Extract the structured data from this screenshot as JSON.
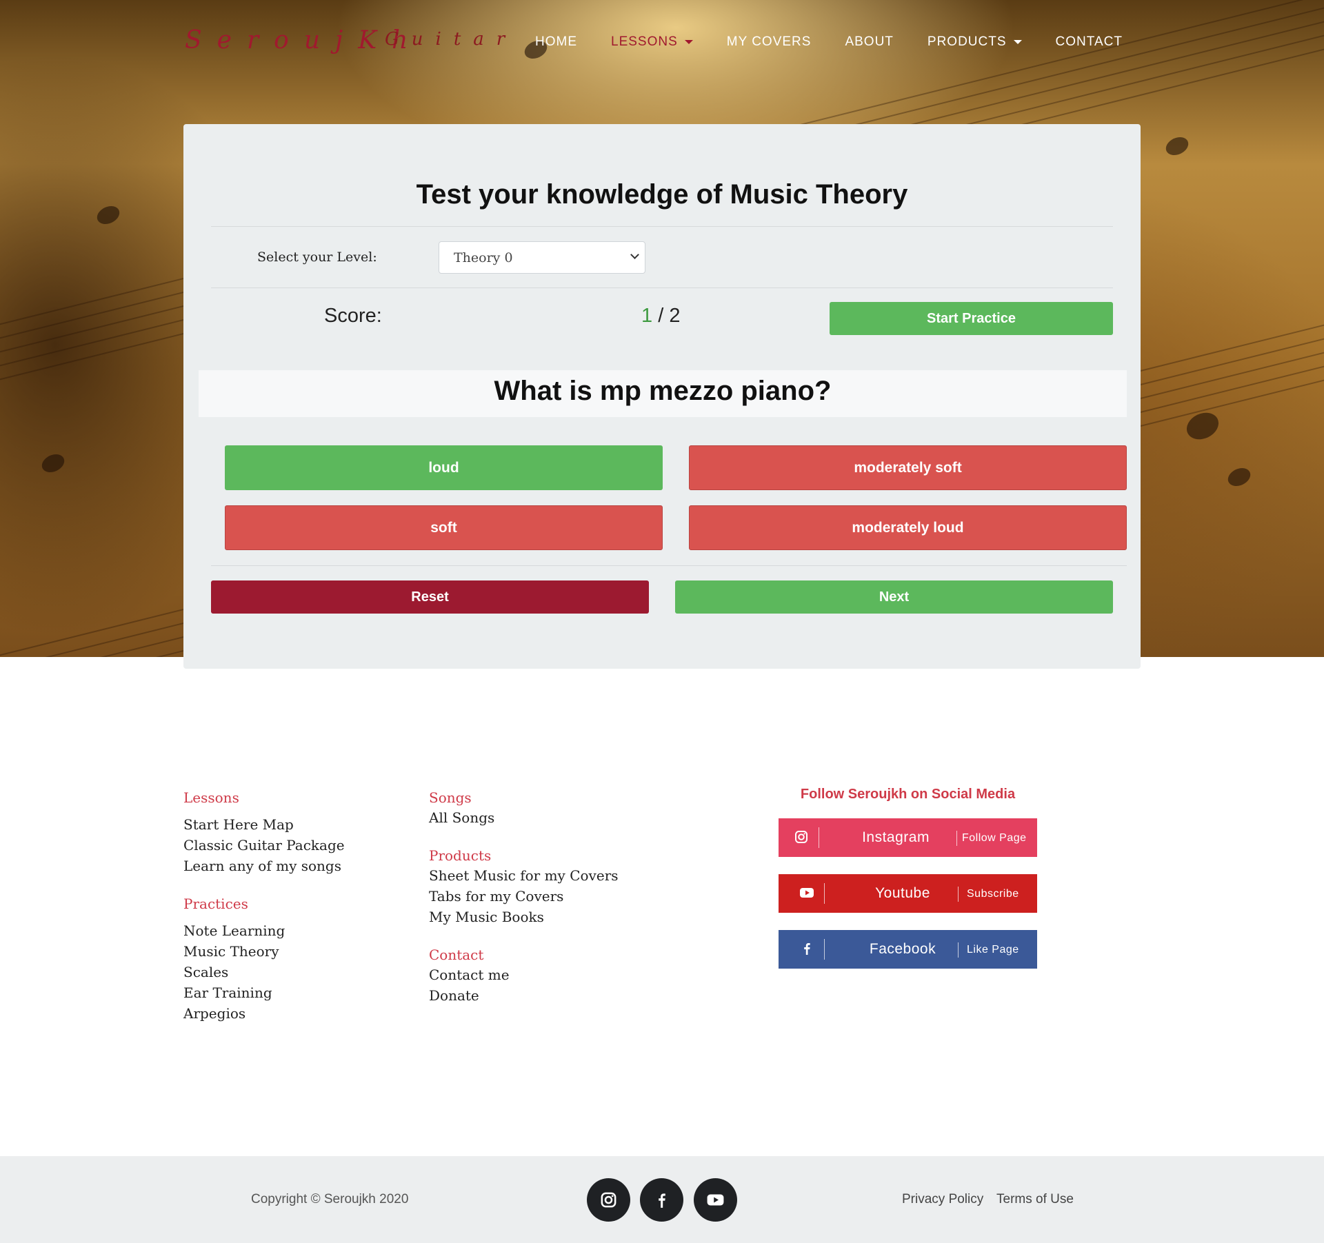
{
  "brand": {
    "name": "SeroujKh",
    "sub": "Guitar"
  },
  "nav": {
    "items": [
      {
        "label": "HOME"
      },
      {
        "label": "LESSONS"
      },
      {
        "label": "MY COVERS"
      },
      {
        "label": "ABOUT"
      },
      {
        "label": "PRODUCTS"
      },
      {
        "label": "CONTACT"
      }
    ],
    "active": "LESSONS"
  },
  "quiz": {
    "title": "Test your knowledge of Music Theory",
    "level_label": "Select your Level:",
    "level_value": "Theory 0",
    "score_label": "Score:",
    "score_current": "1",
    "score_separator": " / ",
    "score_total": "2",
    "start_label": "Start Practice",
    "question": "What is mp mezzo piano?",
    "answers": [
      "loud",
      "moderately soft",
      "soft",
      "moderately loud"
    ],
    "reset_label": "Reset",
    "next_label": "Next"
  },
  "footer": {
    "lessons": {
      "heading": "Lessons",
      "links": [
        "Start Here Map",
        "Classic Guitar Package",
        "Learn any of my songs"
      ]
    },
    "practices": {
      "heading": "Practices",
      "links": [
        "Note Learning",
        "Music Theory",
        "Scales",
        "Ear Training",
        "Arpegios"
      ]
    },
    "songs": {
      "heading": "Songs",
      "links": [
        "All Songs"
      ]
    },
    "products": {
      "heading": "Products",
      "links": [
        "Sheet Music for my Covers",
        "Tabs for my Covers",
        "My Music Books"
      ]
    },
    "contact": {
      "heading": "Contact",
      "links": [
        "Contact me",
        "Donate"
      ]
    },
    "social": {
      "title": "Follow Seroujkh on Social Media",
      "buttons": [
        {
          "name": "Instagram",
          "action": "Follow Page",
          "color": "#e4405f",
          "icon": "instagram-icon"
        },
        {
          "name": "Youtube",
          "action": "Subscribe",
          "color": "#cd201f",
          "icon": "youtube-icon"
        },
        {
          "name": "Facebook",
          "action": "Like Page",
          "color": "#3b5998",
          "icon": "facebook-icon"
        }
      ]
    }
  },
  "bottom": {
    "copyright": "Copyright © Seroujkh 2020",
    "privacy": "Privacy Policy",
    "terms": "Terms of Use"
  }
}
